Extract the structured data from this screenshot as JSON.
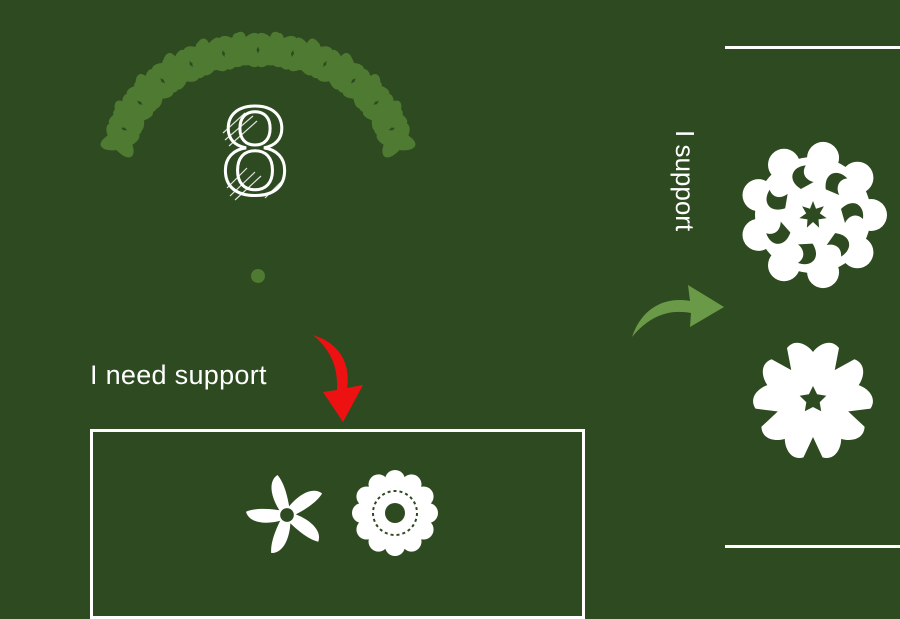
{
  "rank": {
    "numeral": "8"
  },
  "labels": {
    "need_support": "I need support",
    "support": "I support"
  },
  "colors": {
    "background": "#2e4a21",
    "laurel": "#4f7a31",
    "red_arrow": "#ee1111",
    "green_arrow": "#6a9a48",
    "white": "#ffffff"
  },
  "icons": {
    "wreath": "laurel-wreath-icon",
    "down_arrow": "red-curved-down-arrow-icon",
    "right_arrow": "green-curved-right-arrow-icon",
    "small_pinwheel": "pinwheel-flower-icon",
    "small_scalloped": "scalloped-flower-icon",
    "big_rosette": "rosette-flower-icon",
    "big_star": "star-flower-icon"
  }
}
